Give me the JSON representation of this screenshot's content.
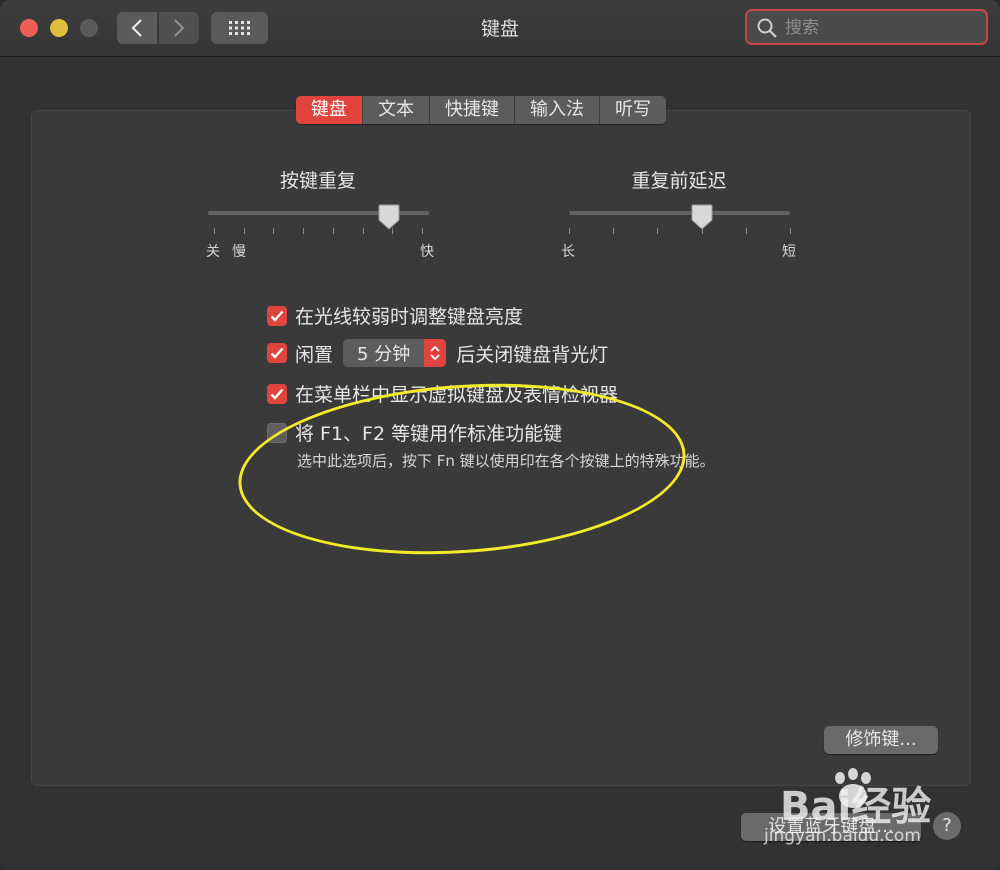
{
  "window": {
    "title": "键盘"
  },
  "search": {
    "placeholder": "搜索"
  },
  "tabs": [
    {
      "label": "键盘",
      "active": true
    },
    {
      "label": "文本",
      "active": false
    },
    {
      "label": "快捷键",
      "active": false
    },
    {
      "label": "输入法",
      "active": false
    },
    {
      "label": "听写",
      "active": false
    }
  ],
  "key_repeat": {
    "title": "按键重复",
    "labels": {
      "off": "关",
      "slow": "慢",
      "fast": "快"
    },
    "level": 0.82
  },
  "delay_until_repeat": {
    "title": "重复前延迟",
    "labels": {
      "long": "长",
      "short": "短"
    },
    "level": 0.6
  },
  "options": {
    "adjust_brightness": {
      "label": "在光线较弱时调整键盘亮度",
      "checked": true
    },
    "backlight_off": {
      "prefix": "闲置",
      "selected_value": "5 分钟",
      "suffix": "后关闭键盘背光灯",
      "checked": true
    },
    "show_viewer": {
      "label": "在菜单栏中显示虚拟键盘及表情检视器",
      "checked": true
    },
    "fn_keys": {
      "label": "将 F1、F2 等键用作标准功能键",
      "hint": "选中此选项后，按下 Fn 键以使用印在各个按键上的特殊功能。",
      "checked": false
    }
  },
  "buttons": {
    "modifier_keys": "修饰键...",
    "bluetooth_keyboard": "设置蓝牙键盘...",
    "help": "?"
  },
  "watermark": {
    "brand": "Bai经验",
    "url": "jingyan.baidu.com"
  },
  "colors": {
    "accent": "#e0443c",
    "annotation": "#f2ea2a"
  }
}
